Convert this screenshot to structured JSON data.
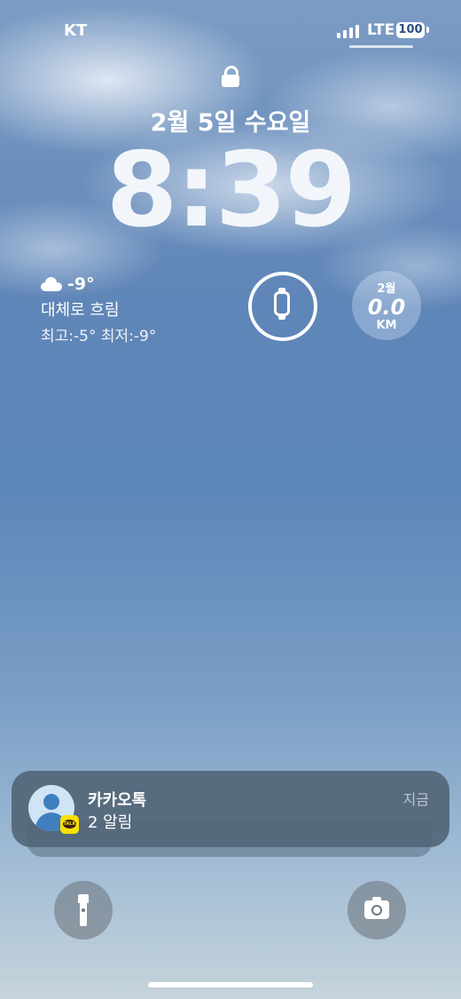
{
  "status_bar": {
    "carrier": "KT",
    "network": "LTE",
    "battery": "100"
  },
  "lock_screen": {
    "date": "2월 5일 수요일",
    "time": "8:39"
  },
  "weather": {
    "icon": "cloud-icon",
    "temperature": "-9°",
    "description": "대체로 흐림",
    "range": "최고:-5° 최저:-9°"
  },
  "watch_widget": {
    "icon": "apple-watch-icon"
  },
  "activity_widget": {
    "month": "2월",
    "value": "0.0",
    "unit": "KM"
  },
  "notification": {
    "app": "카카오톡",
    "body": "2 알림",
    "time": "지금",
    "badge": "TALK",
    "badge_color": "#FBE100"
  },
  "quick_actions": {
    "left_icon": "flashlight-icon",
    "right_icon": "camera-icon"
  }
}
